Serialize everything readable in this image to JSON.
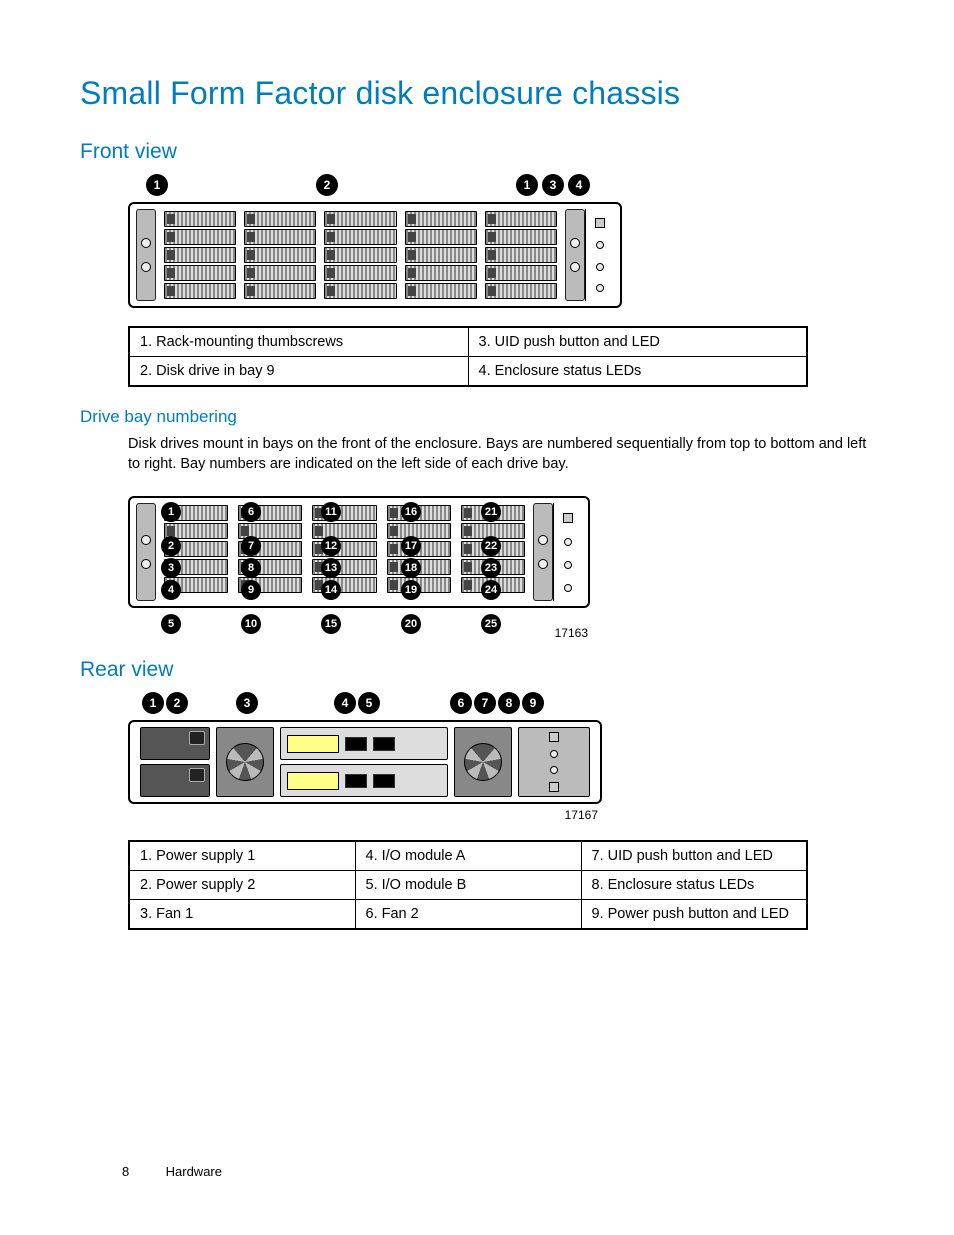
{
  "title": "Small Form Factor disk enclosure chassis",
  "sections": {
    "front": {
      "heading": "Front view",
      "callouts_top": [
        "1",
        "2",
        "1",
        "3",
        "4"
      ],
      "key": [
        [
          "1. Rack-mounting thumbscrews",
          "3. UID push button and LED"
        ],
        [
          "2. Disk drive in bay 9",
          "4. Enclosure status LEDs"
        ]
      ]
    },
    "drivebay": {
      "heading": "Drive bay numbering",
      "paragraph": "Disk drives mount in bays on the front of the enclosure. Bays are numbered sequentially from top to bottom and left to right. Bay numbers are indicated on the left side of each drive bay.",
      "cols": [
        [
          "1",
          "2",
          "3",
          "4",
          "5"
        ],
        [
          "6",
          "7",
          "8",
          "9",
          "10"
        ],
        [
          "11",
          "12",
          "13",
          "14",
          "15"
        ],
        [
          "16",
          "17",
          "18",
          "19",
          "20"
        ],
        [
          "21",
          "22",
          "23",
          "24",
          "25"
        ]
      ],
      "figure_id": "17163"
    },
    "rear": {
      "heading": "Rear view",
      "callouts_top": [
        "1",
        "2",
        "3",
        "4",
        "5",
        "6",
        "7",
        "8",
        "9"
      ],
      "figure_id": "17167",
      "key": [
        [
          "1. Power supply 1",
          "4. I/O module A",
          "7. UID push button and LED"
        ],
        [
          "2. Power supply 2",
          "5. I/O module B",
          "8. Enclosure status LEDs"
        ],
        [
          "3. Fan 1",
          "6. Fan 2",
          "9. Power push button and LED"
        ]
      ]
    }
  },
  "footer": {
    "page": "8",
    "section": "Hardware"
  }
}
